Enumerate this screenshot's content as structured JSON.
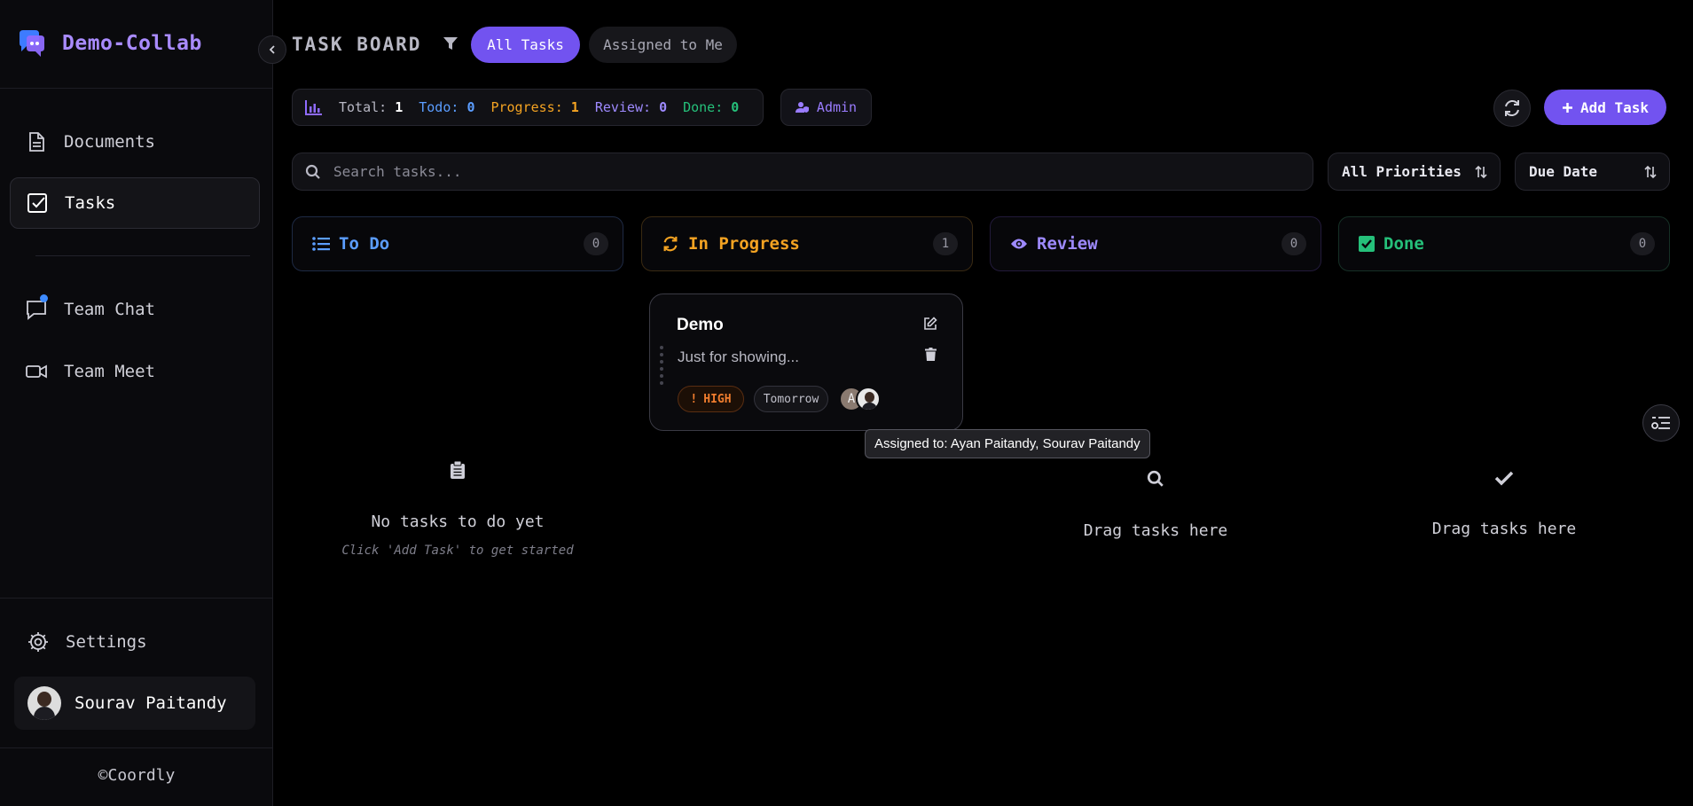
{
  "brand": {
    "name": "Demo-Collab"
  },
  "sidebar": {
    "items": [
      {
        "label": "Documents"
      },
      {
        "label": "Tasks"
      },
      {
        "label": "Team Chat"
      },
      {
        "label": "Team Meet"
      }
    ],
    "settings_label": "Settings",
    "user_name": "Sourav Paitandy",
    "copyright": "©Coordly"
  },
  "header": {
    "title": "TASK BOARD",
    "filter_all": "All Tasks",
    "filter_assigned": "Assigned to Me"
  },
  "stats": {
    "total_label": "Total:",
    "total": "1",
    "todo_label": "Todo:",
    "todo": "0",
    "progress_label": "Progress:",
    "progress": "1",
    "review_label": "Review:",
    "review": "0",
    "done_label": "Done:",
    "done": "0"
  },
  "role_badge": "Admin",
  "add_task_label": "Add Task",
  "search": {
    "placeholder": "Search tasks..."
  },
  "priority_select": "All Priorities",
  "sort_select": "Due Date",
  "columns": [
    {
      "title": "To Do",
      "count": "0",
      "color": "#5b9dff"
    },
    {
      "title": "In Progress",
      "count": "1",
      "color": "#f4a322"
    },
    {
      "title": "Review",
      "count": "0",
      "color": "#9e8aff"
    },
    {
      "title": "Done",
      "count": "0",
      "color": "#25c07a"
    }
  ],
  "task_card": {
    "title": "Demo",
    "description": "Just for showing...",
    "priority": "HIGH",
    "due": "Tomorrow",
    "assignee_initial": "A"
  },
  "tooltip": "Assigned to: Ayan Paitandy, Sourav Paitandy",
  "empty_states": {
    "todo_title": "No tasks to do yet",
    "todo_sub": "Click 'Add Task' to get started",
    "review_title": "Drag tasks here",
    "done_title": "Drag tasks here"
  },
  "colors": {
    "accent": "#7253f0",
    "brand": "#a98bff",
    "todo": "#5b9dff",
    "progress": "#f4a322",
    "review": "#9e8aff",
    "done": "#25c07a",
    "priority_high": "#f07d2e"
  },
  "icons": [
    "logo-icon",
    "chevron-left-icon",
    "document-icon",
    "checkbox-icon",
    "chat-icon",
    "video-icon",
    "gear-icon",
    "filter-icon",
    "bar-chart-icon",
    "user-shield-icon",
    "refresh-icon",
    "plus-icon",
    "search-icon",
    "sort-icon",
    "list-icon",
    "sync-icon",
    "eye-icon",
    "check-square-icon",
    "edit-icon",
    "trash-icon",
    "clipboard-icon",
    "checkmark-icon",
    "filter-lines-icon"
  ]
}
